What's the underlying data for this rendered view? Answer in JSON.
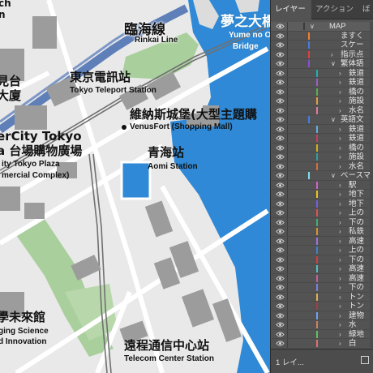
{
  "map": {
    "colors": {
      "water": "#2f89d6",
      "land": "#e9e9e9",
      "park": "#a9cf9c",
      "building": "#9c9c9c",
      "road": "#ffffff",
      "rail": "#6f6f6f",
      "highway_blue": "#5e7fb8"
    },
    "labels": {
      "rinkai_jp": "臨海線",
      "rinkai_en": "Rinkai Line",
      "yume_jp": "夢之大橋",
      "yume_en1": "Yume no Ohashi",
      "yume_en2": "Bridge",
      "teleport_jp": "東京電訊站",
      "teleport_en": "Tokyo Teleport Station",
      "venus_jp": "維納斯城堡(大型主題購",
      "venus_en": "VenusFort (Shopping Mall)",
      "aomi_jp": "青海站",
      "aomi_en": "Aomi Station",
      "aquacity_jp1": "erCity Tokyo",
      "aquacity_jp2": "a 台場購物廣場",
      "aquacity_en1": "ity Tokyo Plaza",
      "aquacity_en2": "mercial Complex)",
      "building_jp1": "見台",
      "building_jp2": "大廈",
      "top_left": "ch",
      "top_left2": "n",
      "miraikan_jp": "學未來館",
      "miraikan_en1": "ging Science",
      "miraikan_en2": "d Innovation",
      "telecom_jp": "遠程通信中心站",
      "telecom_en": "Telecom Center Station"
    }
  },
  "panel": {
    "tabs": [
      "レイヤー",
      "アクション",
      "ぼ"
    ],
    "layer_count": "1 レイ...",
    "rows": [
      {
        "label": "MAP",
        "indent": 0,
        "chev": "v",
        "color": "#3a3a3a",
        "top": true
      },
      {
        "label": "ますく",
        "indent": 1,
        "chev": "",
        "color": "#f08030"
      },
      {
        "label": "スケー",
        "indent": 1,
        "chev": "",
        "color": "#4a7be0"
      },
      {
        "label": "指示点",
        "indent": 1,
        "chev": ">",
        "color": "#e04040"
      },
      {
        "label": "繁体語",
        "indent": 1,
        "chev": "v",
        "color": "#8a4fd0"
      },
      {
        "label": "鉄道",
        "indent": 2,
        "chev": ">",
        "color": "#20b0b0"
      },
      {
        "label": "鉄道",
        "indent": 2,
        "chev": ">",
        "color": "#9a60c8"
      },
      {
        "label": "橋の",
        "indent": 2,
        "chev": ">",
        "color": "#5ab050"
      },
      {
        "label": "施設",
        "indent": 2,
        "chev": ">",
        "color": "#e0a040"
      },
      {
        "label": "水名",
        "indent": 2,
        "chev": ">",
        "color": "#e07aa0"
      },
      {
        "label": "英語文",
        "indent": 1,
        "chev": "v",
        "color": "#4a7be0"
      },
      {
        "label": "鉄道",
        "indent": 2,
        "chev": ">",
        "color": "#60b0e0"
      },
      {
        "label": "鉄道",
        "indent": 2,
        "chev": ">",
        "color": "#c04060"
      },
      {
        "label": "橋の",
        "indent": 2,
        "chev": ">",
        "color": "#d0b020"
      },
      {
        "label": "施設",
        "indent": 2,
        "chev": ">",
        "color": "#30a0a0"
      },
      {
        "label": "水名",
        "indent": 2,
        "chev": ">",
        "color": "#d07040"
      },
      {
        "label": "ベースマ",
        "indent": 1,
        "chev": "v",
        "color": "#80e0f0"
      },
      {
        "label": "駅",
        "indent": 2,
        "chev": ">",
        "color": "#d060d0"
      },
      {
        "label": "地下",
        "indent": 2,
        "chev": ">",
        "color": "#f0c020"
      },
      {
        "label": "地下",
        "indent": 2,
        "chev": ">",
        "color": "#7060e0"
      },
      {
        "label": "上の",
        "indent": 2,
        "chev": ">",
        "color": "#e05050"
      },
      {
        "label": "下の",
        "indent": 2,
        "chev": ">",
        "color": "#40b070"
      },
      {
        "label": "私鉄",
        "indent": 2,
        "chev": ">",
        "color": "#e09030"
      },
      {
        "label": "高速",
        "indent": 2,
        "chev": ">",
        "color": "#a070e0"
      },
      {
        "label": "上の",
        "indent": 2,
        "chev": ">",
        "color": "#4080d0"
      },
      {
        "label": "下の",
        "indent": 2,
        "chev": ">",
        "color": "#d04040"
      },
      {
        "label": "高速",
        "indent": 2,
        "chev": ">",
        "color": "#50c0c0"
      },
      {
        "label": "高速",
        "indent": 2,
        "chev": ">",
        "color": "#c060a0"
      },
      {
        "label": "下の",
        "indent": 2,
        "chev": ">",
        "color": "#8080e0"
      },
      {
        "label": "トン",
        "indent": 2,
        "chev": ">",
        "color": "#e0b050"
      },
      {
        "label": "トン",
        "indent": 2,
        "chev": ">",
        "color": "#a04040"
      },
      {
        "label": "建物",
        "indent": 2,
        "chev": ">",
        "color": "#70a0f0"
      },
      {
        "label": "水",
        "indent": 2,
        "chev": ">",
        "color": "#d08060"
      },
      {
        "label": "緑地",
        "indent": 2,
        "chev": ">",
        "color": "#60c060"
      },
      {
        "label": "白",
        "indent": 2,
        "chev": ">",
        "color": "#e07070"
      }
    ]
  }
}
